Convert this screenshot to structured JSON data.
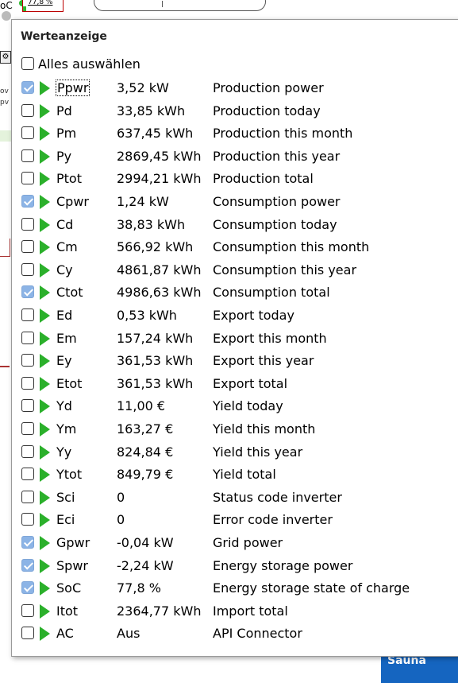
{
  "background": {
    "soc_label": "oC",
    "soc_value": "77,8 %",
    "fragments": [
      "ov",
      "pv"
    ],
    "sauna_label": "Sauna"
  },
  "popup": {
    "title": "Werteanzeige",
    "select_all_label": "Alles auswählen",
    "select_all_checked": false,
    "rows": [
      {
        "abbr": "Ppwr",
        "value": "3,52 kW",
        "desc": "Production power",
        "checked": true
      },
      {
        "abbr": "Pd",
        "value": "33,85 kWh",
        "desc": "Production today",
        "checked": false
      },
      {
        "abbr": "Pm",
        "value": "637,45 kWh",
        "desc": "Production this month",
        "checked": false
      },
      {
        "abbr": "Py",
        "value": "2869,45 kWh",
        "desc": "Production this year",
        "checked": false
      },
      {
        "abbr": "Ptot",
        "value": "2994,21 kWh",
        "desc": "Production total",
        "checked": false
      },
      {
        "abbr": "Cpwr",
        "value": "1,24 kW",
        "desc": "Consumption power",
        "checked": true
      },
      {
        "abbr": "Cd",
        "value": "38,83 kWh",
        "desc": "Consumption today",
        "checked": false
      },
      {
        "abbr": "Cm",
        "value": "566,92 kWh",
        "desc": "Consumption this month",
        "checked": false
      },
      {
        "abbr": "Cy",
        "value": "4861,87 kWh",
        "desc": "Consumption this year",
        "checked": false
      },
      {
        "abbr": "Ctot",
        "value": "4986,63 kWh",
        "desc": "Consumption total",
        "checked": true
      },
      {
        "abbr": "Ed",
        "value": "0,53 kWh",
        "desc": "Export today",
        "checked": false
      },
      {
        "abbr": "Em",
        "value": "157,24 kWh",
        "desc": "Export this month",
        "checked": false
      },
      {
        "abbr": "Ey",
        "value": "361,53 kWh",
        "desc": "Export this year",
        "checked": false
      },
      {
        "abbr": "Etot",
        "value": "361,53 kWh",
        "desc": "Export total",
        "checked": false
      },
      {
        "abbr": "Yd",
        "value": "11,00 €",
        "desc": "Yield today",
        "checked": false
      },
      {
        "abbr": "Ym",
        "value": "163,27 €",
        "desc": "Yield this month",
        "checked": false
      },
      {
        "abbr": "Yy",
        "value": "824,84 €",
        "desc": "Yield this year",
        "checked": false
      },
      {
        "abbr": "Ytot",
        "value": "849,79 €",
        "desc": "Yield total",
        "checked": false
      },
      {
        "abbr": "Sci",
        "value": "0",
        "desc": "Status code inverter",
        "checked": false
      },
      {
        "abbr": "Eci",
        "value": "0",
        "desc": "Error code inverter",
        "checked": false
      },
      {
        "abbr": "Gpwr",
        "value": "-0,04 kW",
        "desc": "Grid power",
        "checked": true
      },
      {
        "abbr": "Spwr",
        "value": "-2,24 kW",
        "desc": "Energy storage power",
        "checked": true
      },
      {
        "abbr": "SoC",
        "value": "77,8 %",
        "desc": "Energy storage state of charge",
        "checked": true
      },
      {
        "abbr": "Itot",
        "value": "2364,77 kWh",
        "desc": "Import total",
        "checked": false
      },
      {
        "abbr": "AC",
        "value": "Aus",
        "desc": "API Connector",
        "checked": false
      }
    ]
  },
  "colors": {
    "checkbox_checked": "#8cb4e6",
    "play_icon": "#2bb02b",
    "sauna_bg": "#1565c0"
  }
}
